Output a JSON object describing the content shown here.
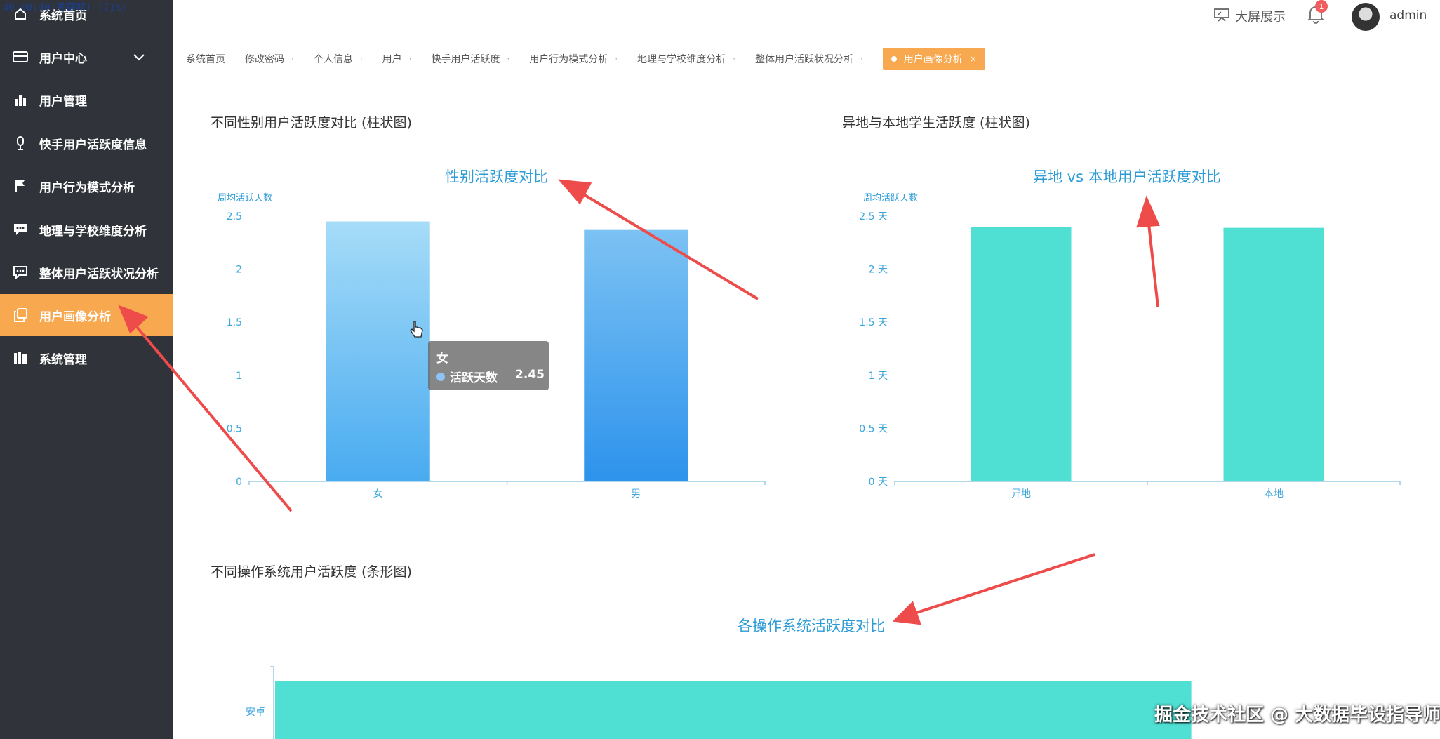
{
  "overlay_timestamp": "00:00:40(关键帧) (71%)",
  "sidebar": {
    "items": [
      {
        "label": "系统首页",
        "icon": "home-icon"
      },
      {
        "label": "用户中心",
        "icon": "card-icon"
      },
      {
        "label": "用户管理",
        "icon": "bar-chart-icon"
      },
      {
        "label": "快手用户活跃度信息",
        "icon": "mic-icon"
      },
      {
        "label": "用户行为模式分析",
        "icon": "flag-icon"
      },
      {
        "label": "地理与学校维度分析",
        "icon": "message-icon"
      },
      {
        "label": "整体用户活跃状况分析",
        "icon": "chat-icon"
      },
      {
        "label": "用户画像分析",
        "icon": "copy-icon"
      },
      {
        "label": "系统管理",
        "icon": "books-icon"
      }
    ],
    "active_index": 7
  },
  "header": {
    "screen_label": "大屏展示",
    "bell_badge": "1",
    "username": "admin"
  },
  "tabs": [
    {
      "label": "系统首页",
      "closable": false
    },
    {
      "label": "修改密码",
      "closable": true
    },
    {
      "label": "个人信息",
      "closable": true
    },
    {
      "label": "用户",
      "closable": true
    },
    {
      "label": "快手用户活跃度",
      "closable": true
    },
    {
      "label": "用户行为模式分析",
      "closable": true
    },
    {
      "label": "地理与学校维度分析",
      "closable": true
    },
    {
      "label": "整体用户活跃状况分析",
      "closable": true
    },
    {
      "label": "用户画像分析",
      "closable": true,
      "active": true
    }
  ],
  "sections": {
    "gender_title": "不同性别用户活跃度对比 (柱状图)",
    "region_title": "异地与本地学生活跃度 (柱状图)",
    "os_title": "不同操作系统用户活跃度 (条形图)"
  },
  "tooltip": {
    "title": "女",
    "series": "活跃天数",
    "value": "2.45"
  },
  "watermark": "掘金技术社区 @ 大数据毕设指导师",
  "accent_color": "#f8a94f",
  "chart_data": [
    {
      "type": "bar",
      "title": "性别活跃度对比",
      "ylabel": "周均活跃天数",
      "categories": [
        "女",
        "男"
      ],
      "values": [
        2.45,
        2.37
      ],
      "ylim": [
        0,
        2.5
      ],
      "yticks": [
        "0",
        "0.5",
        "1",
        "1.5",
        "2",
        "2.5"
      ]
    },
    {
      "type": "bar",
      "title": "异地 vs 本地用户活跃度对比",
      "ylabel": "周均活跃天数",
      "categories": [
        "异地",
        "本地"
      ],
      "values": [
        2.4,
        2.39
      ],
      "ylim": [
        0,
        2.5
      ],
      "yticks": [
        "0 天",
        "0.5 天",
        "1 天",
        "1.5 天",
        "2 天",
        "2.5 天"
      ]
    },
    {
      "type": "bar",
      "title": "各操作系统活跃度对比",
      "categories": [
        "安卓"
      ],
      "values": [
        2.4
      ]
    }
  ]
}
